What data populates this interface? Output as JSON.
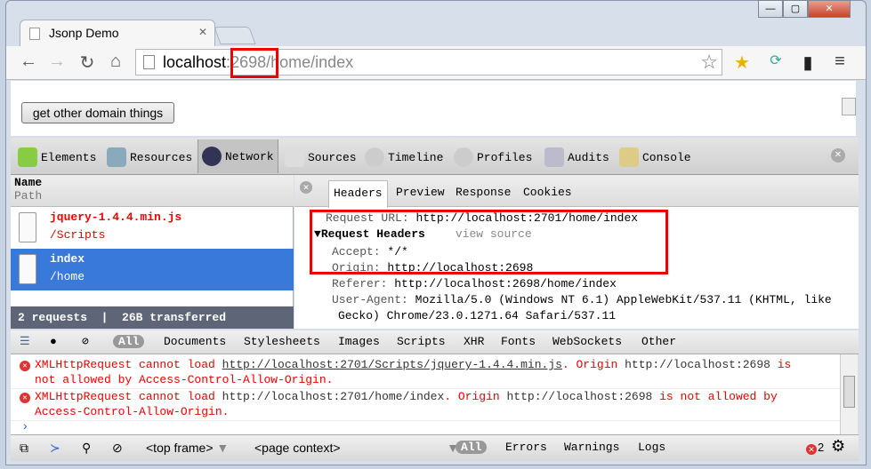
{
  "browser": {
    "tab_title": "Jsonp Demo",
    "url_host": "localhost",
    "url_port": "2698",
    "url_path": "/home/index",
    "url_sep": ":"
  },
  "page": {
    "button_label": "get other domain things"
  },
  "devtools": {
    "panels": [
      "Elements",
      "Resources",
      "Network",
      "Sources",
      "Timeline",
      "Profiles",
      "Audits",
      "Console"
    ],
    "active_panel": "Network"
  },
  "network": {
    "header_name": "Name",
    "header_path": "Path",
    "requests": [
      {
        "name": "jquery-1.4.4.min.js",
        "path": "/Scripts",
        "status": "error"
      },
      {
        "name": "index",
        "path": "/home",
        "status": "selected"
      }
    ],
    "summary": "2 requests  |  26B transferred",
    "detail_tabs": [
      "Headers",
      "Preview",
      "Response",
      "Cookies"
    ],
    "active_detail_tab": "Headers",
    "request_url_label": "Request URL:",
    "request_url": "http://localhost:2701/home/index",
    "request_headers_label": "Request Headers",
    "view_source": "view source",
    "headers": [
      {
        "k": "Accept:",
        "v": "*/*"
      },
      {
        "k": "Origin:",
        "v": "http://localhost:2698"
      },
      {
        "k": "Referer:",
        "v": "http://localhost:2698/home/index"
      },
      {
        "k": "User-Agent:",
        "v": "Mozilla/5.0 (Windows NT 6.1) AppleWebKit/537.11 (KHTML, like"
      }
    ],
    "ua_cont": "Gecko) Chrome/23.0.1271.64 Safari/537.11"
  },
  "console": {
    "filters": [
      "All",
      "Documents",
      "Stylesheets",
      "Images",
      "Scripts",
      "XHR",
      "Fonts",
      "WebSockets",
      "Other"
    ],
    "messages": [
      {
        "a": "XMLHttpRequest cannot load ",
        "url": "http://localhost:2701/Scripts/jquery-1.4.4.min.js",
        "b": ". Origin ",
        "origin": "http://localhost:2698",
        "c": " is",
        "d": "not allowed by Access-Control-Allow-Origin."
      },
      {
        "a": "XMLHttpRequest cannot load ",
        "url": "http://localhost:2701/home/index",
        "b": ". Origin ",
        "origin": "http://localhost:2698",
        "c": " is not allowed by",
        "d": "Access-Control-Allow-Origin."
      }
    ],
    "prompt": "›",
    "frame": "<top frame>",
    "context": "<page context>",
    "levels": [
      "All",
      "Errors",
      "Warnings",
      "Logs"
    ],
    "error_count": "2"
  },
  "colors": {
    "highlight": "#e00000",
    "selected_row": "#3879d9",
    "error": "#e00000"
  }
}
